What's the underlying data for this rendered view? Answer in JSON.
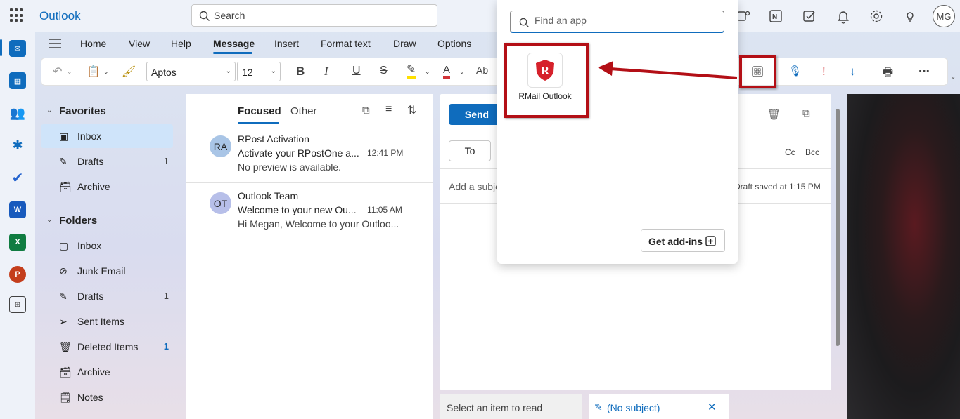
{
  "app": {
    "title": "Outlook"
  },
  "search": {
    "placeholder": "Search"
  },
  "user": {
    "initials": "MG"
  },
  "ribbon": {
    "tabs": [
      "Home",
      "View",
      "Help",
      "Message",
      "Insert",
      "Format text",
      "Draw",
      "Options"
    ],
    "active_tab": "Message",
    "font_name": "Aptos",
    "font_size": "12"
  },
  "folders": {
    "favorites_header": "Favorites",
    "favorites": [
      {
        "label": "Inbox",
        "count": "",
        "selected": true
      },
      {
        "label": "Drafts",
        "count": "1"
      },
      {
        "label": "Archive",
        "count": ""
      }
    ],
    "folders_header": "Folders",
    "items": [
      {
        "label": "Inbox",
        "count": ""
      },
      {
        "label": "Junk Email",
        "count": ""
      },
      {
        "label": "Drafts",
        "count": "1"
      },
      {
        "label": "Sent Items",
        "count": ""
      },
      {
        "label": "Deleted Items",
        "count": "1"
      },
      {
        "label": "Archive",
        "count": ""
      },
      {
        "label": "Notes",
        "count": ""
      }
    ]
  },
  "mail_list": {
    "tab_focused": "Focused",
    "tab_other": "Other",
    "messages": [
      {
        "initials": "RA",
        "from": "RPost Activation",
        "subject": "Activate your RPostOne a...",
        "time": "12:41 PM",
        "preview": "No preview is available.",
        "avatar_color": "#a9c5e6"
      },
      {
        "initials": "OT",
        "from": "Outlook Team",
        "subject": "Welcome to your new Ou...",
        "time": "11:05 AM",
        "preview": "Hi Megan, Welcome to your Outloo...",
        "avatar_color": "#b7bfe9"
      }
    ]
  },
  "compose": {
    "send_label": "Send",
    "to_label": "To",
    "cc_label": "Cc",
    "bcc_label": "Bcc",
    "subject_placeholder": "Add a subje",
    "draft_status": "Draft saved at 1:15 PM"
  },
  "bottom": {
    "read_label": "Select an item to read",
    "draft_label": "(No subject)"
  },
  "apps_flyout": {
    "search_placeholder": "Find an app",
    "apps": [
      {
        "label": "RMail Outlook"
      }
    ],
    "get_addins_label": "Get add-ins"
  },
  "colors": {
    "accent": "#0f6cbd",
    "highlight": "#b30f16"
  }
}
